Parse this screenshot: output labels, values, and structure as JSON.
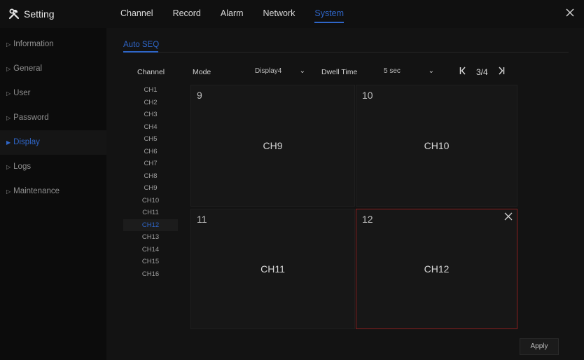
{
  "header": {
    "title": "Setting",
    "tabs": [
      {
        "label": "Channel"
      },
      {
        "label": "Record"
      },
      {
        "label": "Alarm"
      },
      {
        "label": "Network"
      },
      {
        "label": "System",
        "active": true
      }
    ]
  },
  "sidebar": {
    "items": [
      {
        "label": "Information"
      },
      {
        "label": "General"
      },
      {
        "label": "User"
      },
      {
        "label": "Password"
      },
      {
        "label": "Display",
        "active": true
      },
      {
        "label": "Logs"
      },
      {
        "label": "Maintenance"
      }
    ]
  },
  "main": {
    "subtab": "Auto SEQ",
    "channel_header": "Channel",
    "channels": [
      "CH1",
      "CH2",
      "CH3",
      "CH4",
      "CH5",
      "CH6",
      "CH7",
      "CH8",
      "CH9",
      "CH10",
      "CH11",
      "CH12",
      "CH13",
      "CH14",
      "CH15",
      "CH16"
    ],
    "selected_channel": "CH12",
    "mode_label": "Mode",
    "mode_value": "Display4",
    "dwell_label": "Dwell Time",
    "dwell_value": "5 sec",
    "page_indicator": "3/4",
    "tiles": [
      {
        "number": "9",
        "name": "CH9"
      },
      {
        "number": "10",
        "name": "CH10"
      },
      {
        "number": "11",
        "name": "CH11"
      },
      {
        "number": "12",
        "name": "CH12",
        "selected": true
      }
    ],
    "apply_label": "Apply"
  },
  "colors": {
    "accent": "#2f66c8",
    "selected_border": "#8a1f1f",
    "background": "#131313"
  },
  "icons": {
    "app": "tools-icon",
    "close": "close-icon",
    "first_page": "first-page-icon",
    "last_page": "last-page-icon",
    "dropdown": "chevron-down-icon"
  }
}
